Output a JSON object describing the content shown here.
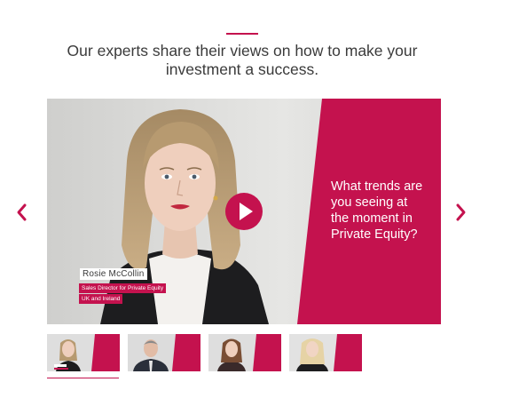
{
  "header": {
    "headline_line1": "Our experts share their views on how to make your",
    "headline_line2": "investment a success."
  },
  "video": {
    "question_line1": "What trends are",
    "question_line2": "you seeing at",
    "question_line3": "the moment in",
    "question_line4": "Private Equity?",
    "speaker_name": "Rosie McCollin",
    "speaker_role": "Sales Director for Private Equity",
    "speaker_region": "UK and Ireland"
  },
  "colors": {
    "accent": "#c4124e",
    "text": "#3b3b3b",
    "background": "#ffffff"
  },
  "icons": {
    "prev": "chevron-left-icon",
    "next": "chevron-right-icon",
    "play": "play-icon"
  },
  "thumbnails": {
    "count": 4,
    "active_index": 0
  }
}
